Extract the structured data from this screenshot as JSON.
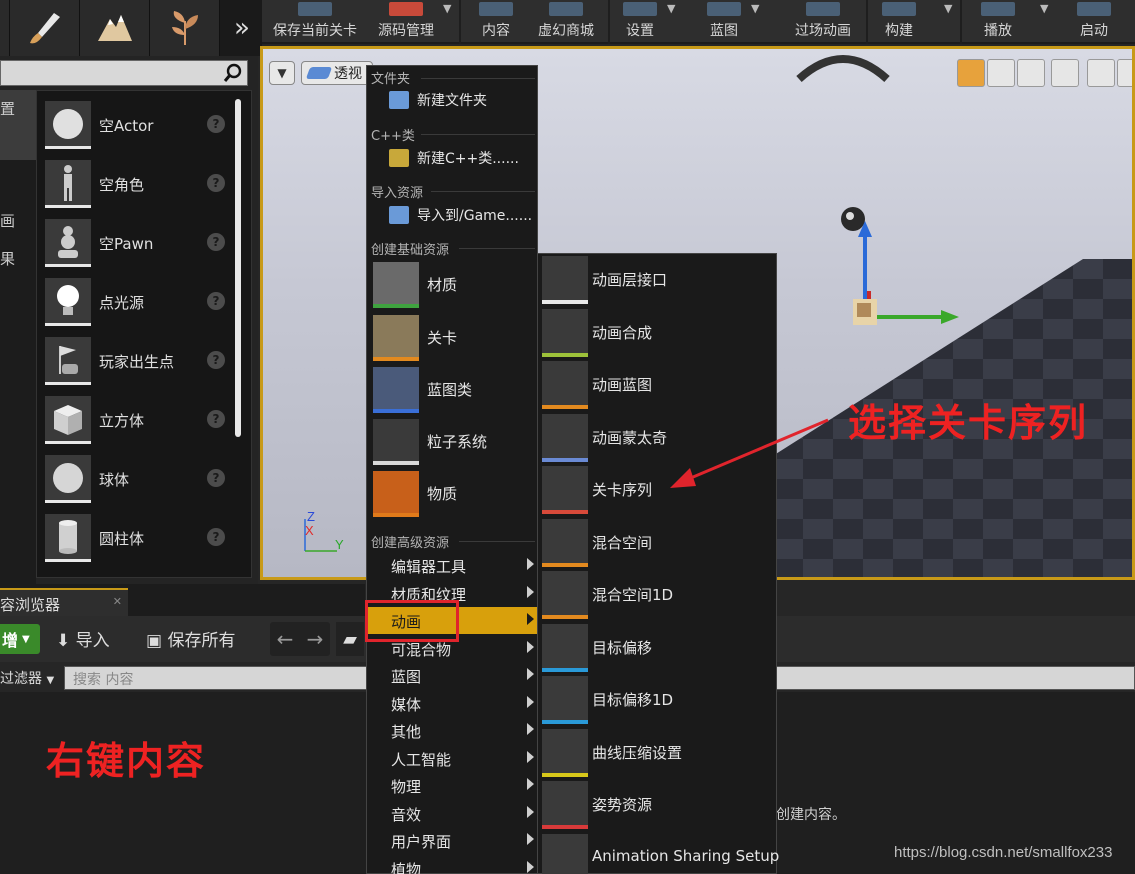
{
  "mode_tabs": [
    {
      "name": "paint-mode-tab",
      "icon": "brush-icon"
    },
    {
      "name": "landscape-mode-tab",
      "icon": "mountain-icon"
    },
    {
      "name": "foliage-mode-tab",
      "icon": "leaf-icon"
    }
  ],
  "main_toolbar": {
    "save_level": "保存当前关卡",
    "source_control": "源码管理",
    "content": "内容",
    "marketplace": "虚幻商城",
    "settings": "设置",
    "blueprints": "蓝图",
    "cinematics": "过场动画",
    "build": "构建",
    "play": "播放",
    "launch": "启动"
  },
  "place_panel": {
    "categories": [
      "置",
      "画",
      "果"
    ],
    "items": [
      {
        "label": "空Actor",
        "icon": "sphere-icon"
      },
      {
        "label": "空角色",
        "icon": "character-icon"
      },
      {
        "label": "空Pawn",
        "icon": "pawn-icon"
      },
      {
        "label": "点光源",
        "icon": "point-light-icon"
      },
      {
        "label": "玩家出生点",
        "icon": "player-start-icon"
      },
      {
        "label": "立方体",
        "icon": "cube-icon"
      },
      {
        "label": "球体",
        "icon": "sphere-icon"
      },
      {
        "label": "圆柱体",
        "icon": "cylinder-icon"
      }
    ]
  },
  "viewport": {
    "perspective_label": "透视",
    "axis_labels": {
      "z": "Z",
      "x": "X",
      "y": "Y"
    }
  },
  "content_browser": {
    "tab_label": "容浏览器",
    "add_label": "增",
    "import_label": "导入",
    "save_all_label": "保存所有",
    "filter_label": "过滤器",
    "search_placeholder": "搜索 内容",
    "empty_message": "创建内容。"
  },
  "context_menu": {
    "sections": {
      "folder": "文件夹",
      "cpp": "C++类",
      "import": "导入资源",
      "basic": "创建基础资源",
      "advanced": "创建高级资源"
    },
    "new_folder": "新建文件夹",
    "new_cpp": "新建C++类......",
    "import_to": "导入到/Game......",
    "basic_assets": [
      {
        "label": "材质",
        "color": "#3fa33f"
      },
      {
        "label": "关卡",
        "color": "#e38a1f"
      },
      {
        "label": "蓝图类",
        "color": "#3a6fd8"
      },
      {
        "label": "粒子系统",
        "color": "#d8d8d8"
      },
      {
        "label": "物质",
        "color": "#e07a1a"
      }
    ],
    "advanced_assets": [
      "编辑器工具",
      "材质和纹理",
      "动画",
      "可混合物",
      "蓝图",
      "媒体",
      "其他",
      "人工智能",
      "物理",
      "音效",
      "用户界面",
      "植物"
    ],
    "selected_advanced": "动画"
  },
  "sub_menu": {
    "items": [
      {
        "label": "动画层接口",
        "color": "#e8e8e8"
      },
      {
        "label": "动画合成",
        "color": "#9ec23a"
      },
      {
        "label": "动画蓝图",
        "color": "#e38a1f"
      },
      {
        "label": "动画蒙太奇",
        "color": "#6a8ad4"
      },
      {
        "label": "关卡序列",
        "color": "#d84a3a"
      },
      {
        "label": "混合空间",
        "color": "#e38a1f"
      },
      {
        "label": "混合空间1D",
        "color": "#e38a1f"
      },
      {
        "label": "目标偏移",
        "color": "#2a9ad8"
      },
      {
        "label": "目标偏移1D",
        "color": "#2a9ad8"
      },
      {
        "label": "曲线压缩设置",
        "color": "#d8c81a"
      },
      {
        "label": "姿势资源",
        "color": "#d83a3a"
      },
      {
        "label": "Animation Sharing Setup",
        "color": "#d8d8d8"
      }
    ]
  },
  "annotations": {
    "select_level_sequence": "选择关卡序列",
    "right_click_content": "右键内容",
    "color": "#ee2222"
  },
  "watermark": "https://blog.csdn.net/smallfox233"
}
